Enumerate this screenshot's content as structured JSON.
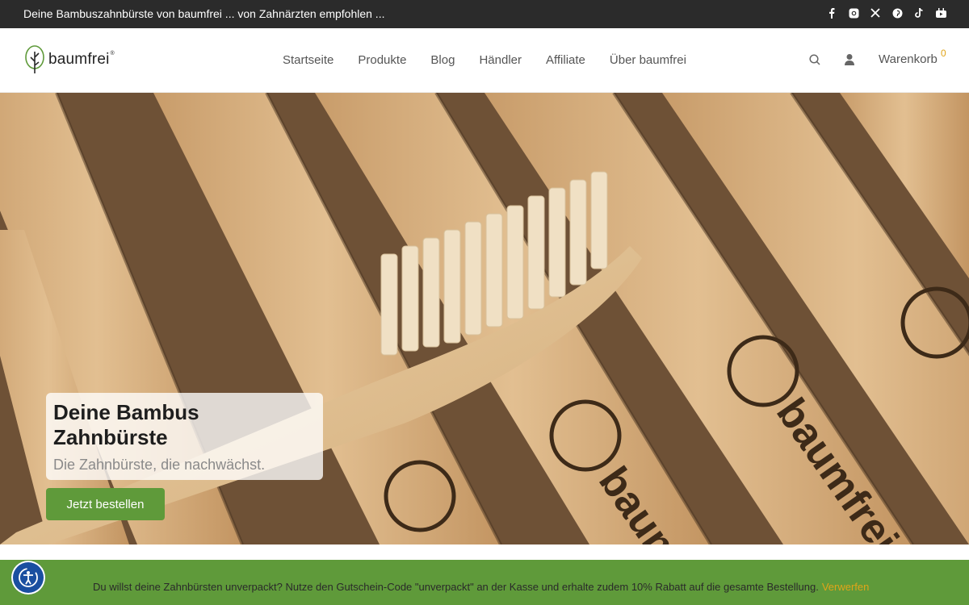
{
  "topbar": {
    "text": "Deine Bambuszahnbürste von baumfrei ... von Zahnärzten empfohlen ...",
    "social": [
      "facebook-icon",
      "instagram-icon",
      "x-icon",
      "pinterest-icon",
      "tiktok-icon",
      "youtube-icon"
    ]
  },
  "header": {
    "logo_text": "baumfrei",
    "logo_tm": "®",
    "nav": [
      "Startseite",
      "Produkte",
      "Blog",
      "Händler",
      "Affiliate",
      "Über baumfrei"
    ],
    "cart_label": "Warenkorb",
    "cart_count": "0"
  },
  "hero": {
    "title_line1": "Deine Bambus",
    "title_line2": "Zahnbürste",
    "subtitle": "Die Zahnbürste, die nachwächst.",
    "cta": "Jetzt bestellen",
    "engraving": "baumfrei"
  },
  "notice": {
    "text": "Du willst deine Zahnbürsten unverpackt? Nutze den Gutschein-Code \"unverpackt\" an der Kasse und erhalte zudem 10% Rabatt auf die gesamte Bestellung.",
    "dismiss": "Verwerfen"
  },
  "colors": {
    "accent_green": "#5f9a3a",
    "accent_orange": "#e0a419",
    "topbar": "#2b2b2b"
  }
}
